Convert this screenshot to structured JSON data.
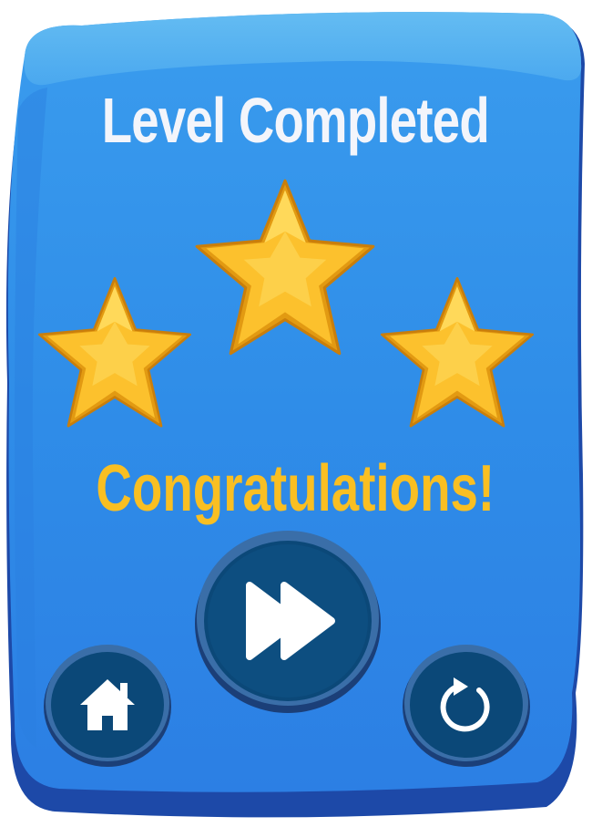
{
  "dialog": {
    "title": "Level Completed",
    "message": "Congratulations!",
    "stars_earned": 3,
    "stars_total": 3
  },
  "buttons": {
    "next": {
      "icon": "fast-forward-icon"
    },
    "home": {
      "icon": "home-icon"
    },
    "restart": {
      "icon": "restart-icon"
    }
  },
  "colors": {
    "panel_top": "#5ab4f0",
    "panel_body": "#2f8fe8",
    "panel_edge": "#1d49a8",
    "title_text": "#f3f5fb",
    "message_text": "#f9bf22",
    "star_fill": "#fcc12d",
    "button_fill": "#0b4878",
    "button_rim": "#19447a"
  }
}
